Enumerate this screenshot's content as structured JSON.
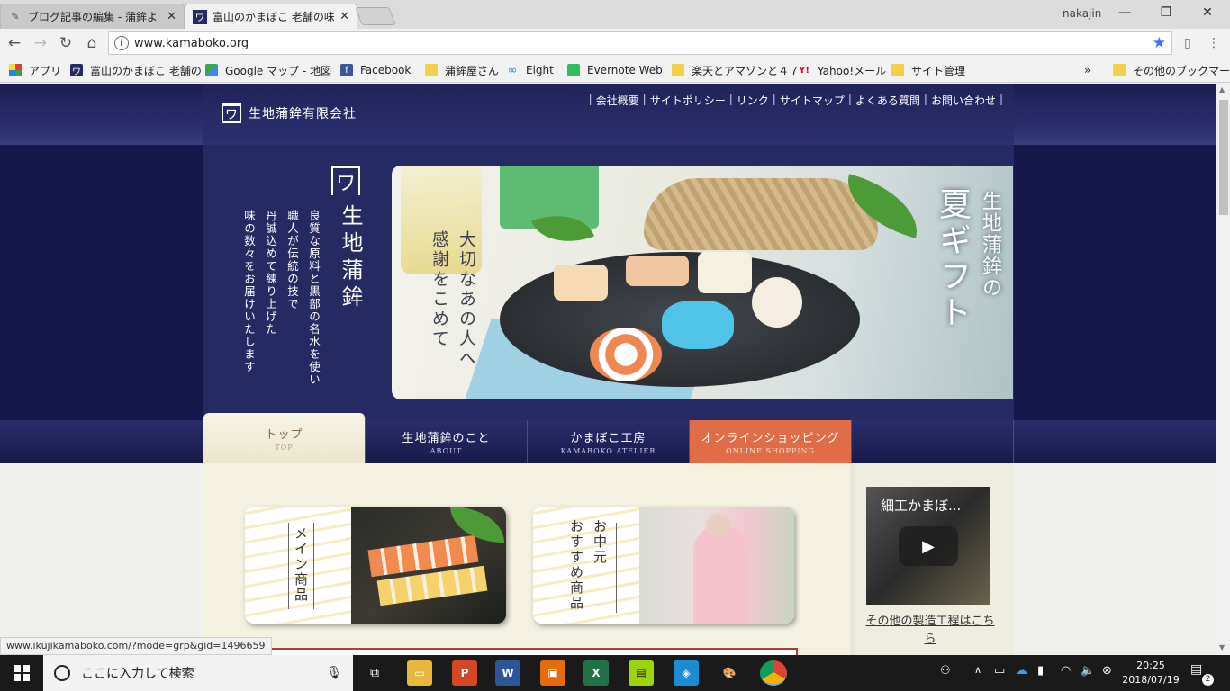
{
  "browser": {
    "tabs": [
      {
        "title": "ブログ記事の編集 - 蒲鉾よ",
        "active": false
      },
      {
        "title": "富山のかまぼこ 老舗の味 生",
        "active": true
      }
    ],
    "user": "nakajin",
    "url": "www.kamaboko.org",
    "bookmarks": [
      {
        "label": "アプリ",
        "icon": "apps-grid-icon"
      },
      {
        "label": "富山のかまぼこ 老舗の",
        "icon": "site-favicon"
      },
      {
        "label": "Google マップ - 地図",
        "icon": "google-maps-icon"
      },
      {
        "label": "Facebook",
        "icon": "facebook-icon"
      },
      {
        "label": "蒲鉾屋さん",
        "icon": "folder-icon"
      },
      {
        "label": "Eight",
        "icon": "eight-icon"
      },
      {
        "label": "Evernote Web",
        "icon": "evernote-icon"
      },
      {
        "label": "楽天とアマゾンと４７",
        "icon": "folder-icon"
      },
      {
        "label": "Yahoo!メール",
        "icon": "yahoo-icon"
      },
      {
        "label": "サイト管理",
        "icon": "folder-icon"
      }
    ],
    "more_bookmarks": "»",
    "other_bookmarks": "その他のブックマーク",
    "status_url": "www.ikujikamaboko.com/?mode=grp&gid=1496659"
  },
  "site": {
    "logo_mark": "ワ",
    "company": "生地蒲鉾有限会社",
    "top_nav": [
      "会社概要",
      "サイトポリシー",
      "リンク",
      "サイトマップ",
      "よくある質問",
      "お問い合わせ"
    ],
    "brand_mark": "ワ",
    "brand_name": "生地蒲鉾",
    "hero_copy": [
      "良質な原料と黒部の名水を使い",
      "職人が伝統の技で",
      "丹誠込めて練り上げた",
      "味の数々をお届けいたします"
    ],
    "photo_copy_left": [
      "大切なあの人へ",
      "感謝をこめて"
    ],
    "photo_copy_right": {
      "small": "生地蒲鉾の",
      "big": "夏ギフト"
    },
    "global_nav": [
      {
        "ja": "トップ",
        "en": "TOP"
      },
      {
        "ja": "生地蒲鉾のこと",
        "en": "ABOUT"
      },
      {
        "ja": "かまぼこ工房",
        "en": "KAMABOKO ATELIER"
      },
      {
        "ja": "オンラインショッピング",
        "en": "ONLINE SHOPPING"
      }
    ],
    "banners": [
      {
        "text": "メイン商品"
      },
      {
        "text_line1": "お中元",
        "text_line2": "おすすめ商品"
      }
    ],
    "video": {
      "title": "細工かまぼ...",
      "link_text": "その他の製造工程はこちら"
    }
  },
  "taskbar": {
    "search_placeholder": "ここに入力して検索",
    "time": "20:25",
    "date": "2018/07/19",
    "notification_count": "2"
  },
  "colors": {
    "header_navy": "#2c3070",
    "shop_orange": "#e06c48",
    "content_cream": "#f5f1e1"
  }
}
